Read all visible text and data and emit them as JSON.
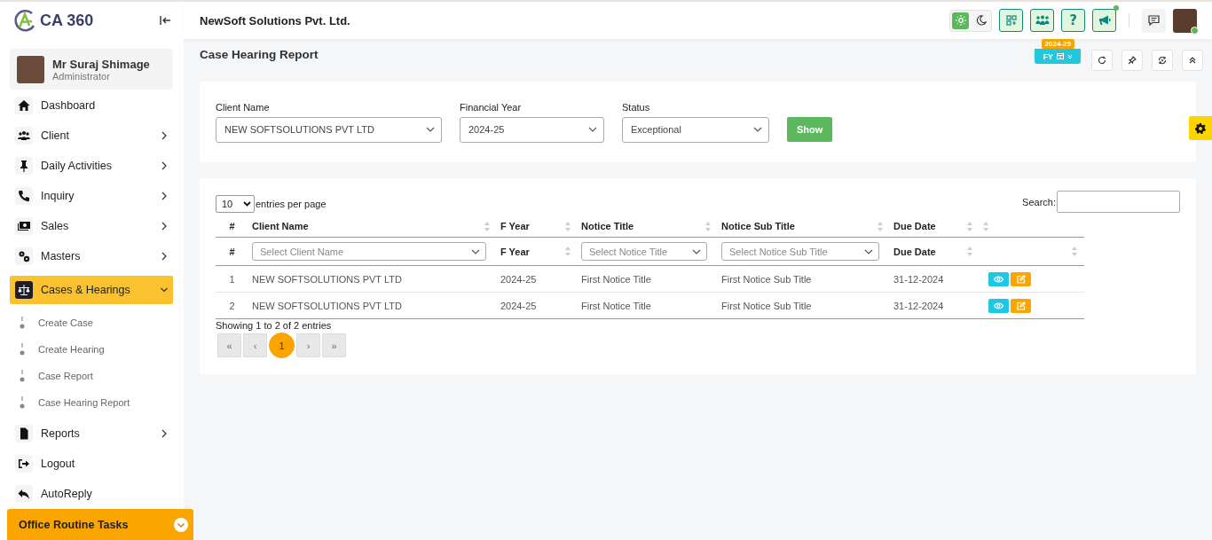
{
  "logo": {
    "text": "CA 360"
  },
  "user": {
    "name": "Mr Suraj Shimage",
    "role": "Administrator"
  },
  "sidebar": {
    "items": [
      {
        "label": "Dashboard",
        "expandable": false,
        "selected": false
      },
      {
        "label": "Client",
        "expandable": true,
        "expanded": false,
        "selected": false
      },
      {
        "label": "Daily Activities",
        "expandable": true,
        "expanded": false,
        "selected": false
      },
      {
        "label": "Inquiry",
        "expandable": true,
        "expanded": false,
        "selected": false
      },
      {
        "label": "Sales",
        "expandable": true,
        "expanded": false,
        "selected": false
      },
      {
        "label": "Masters",
        "expandable": true,
        "expanded": false,
        "selected": false
      },
      {
        "label": "Cases & Hearings",
        "expandable": true,
        "expanded": true,
        "selected": true,
        "children": [
          {
            "label": "Create Case"
          },
          {
            "label": "Create Hearing"
          },
          {
            "label": "Case Report"
          },
          {
            "label": "Case Hearing Report"
          }
        ]
      },
      {
        "label": "Reports",
        "expandable": true,
        "expanded": false,
        "selected": false
      },
      {
        "label": "Logout",
        "expandable": false,
        "selected": false
      },
      {
        "label": "AutoReply",
        "expandable": false,
        "selected": false
      }
    ],
    "footer": {
      "label": "Office Routine Tasks"
    }
  },
  "header": {
    "company": "NewSoft Solutions Pvt. Ltd.",
    "theme": [
      {
        "kind": "light",
        "selected": true
      },
      {
        "kind": "dark",
        "selected": false
      }
    ],
    "help": "?",
    "announcement_unread": true,
    "user_online": true
  },
  "toolbar": {
    "fy_label": "FY",
    "fy_badge": "2024-25"
  },
  "page_title": "Case Hearing Report",
  "filters": [
    {
      "label": "Client Name",
      "value": "NEW SOFTSOLUTIONS PVT LTD"
    },
    {
      "label": "Financial Year",
      "value": "2024-25"
    },
    {
      "label": "Status",
      "value": "Exceptional"
    }
  ],
  "show_button": "Show",
  "table": {
    "page_size": "10",
    "page_size_label": "entries per page",
    "search_label": "Search:",
    "columns": [
      {
        "label": "#",
        "sortable": false
      },
      {
        "label": "Client Name",
        "sortable": true
      },
      {
        "label": "F Year",
        "sortable": true
      },
      {
        "label": "Notice Title",
        "sortable": true
      },
      {
        "label": "Notice Sub Title",
        "sortable": true
      },
      {
        "label": "Due Date",
        "sortable": true
      },
      {
        "sortable": true
      }
    ],
    "filter_row": [
      {
        "kind": "text",
        "label": "#",
        "sortable": false
      },
      {
        "kind": "select",
        "placeholder": "Select Client Name"
      },
      {
        "kind": "text",
        "label": "F Year",
        "sortable": true
      },
      {
        "kind": "select",
        "placeholder": "Select Notice Title"
      },
      {
        "kind": "select",
        "placeholder": "Select Notice Sub Title"
      },
      {
        "kind": "text",
        "label": "Due Date",
        "sortable": true
      },
      {
        "kind": "blank",
        "sortable": true
      }
    ],
    "rows": [
      {
        "cells": [
          "1",
          "NEW SOFTSOLUTIONS PVT LTD",
          "2024-25",
          "First Notice Title",
          "First Notice Sub Title",
          "31-12-2024"
        ]
      },
      {
        "cells": [
          "2",
          "NEW SOFTSOLUTIONS PVT LTD",
          "2024-25",
          "First Notice Title",
          "First Notice Sub Title",
          "31-12-2024"
        ]
      }
    ],
    "info": "Showing 1 to 2 of 2 entries",
    "pagination": [
      {
        "label": "«",
        "selected": false,
        "disabled": true
      },
      {
        "label": "‹",
        "selected": false,
        "disabled": true
      },
      {
        "label": "1",
        "selected": true,
        "disabled": false
      },
      {
        "label": "›",
        "selected": false,
        "disabled": true
      },
      {
        "label": "»",
        "selected": false,
        "disabled": true
      }
    ]
  }
}
